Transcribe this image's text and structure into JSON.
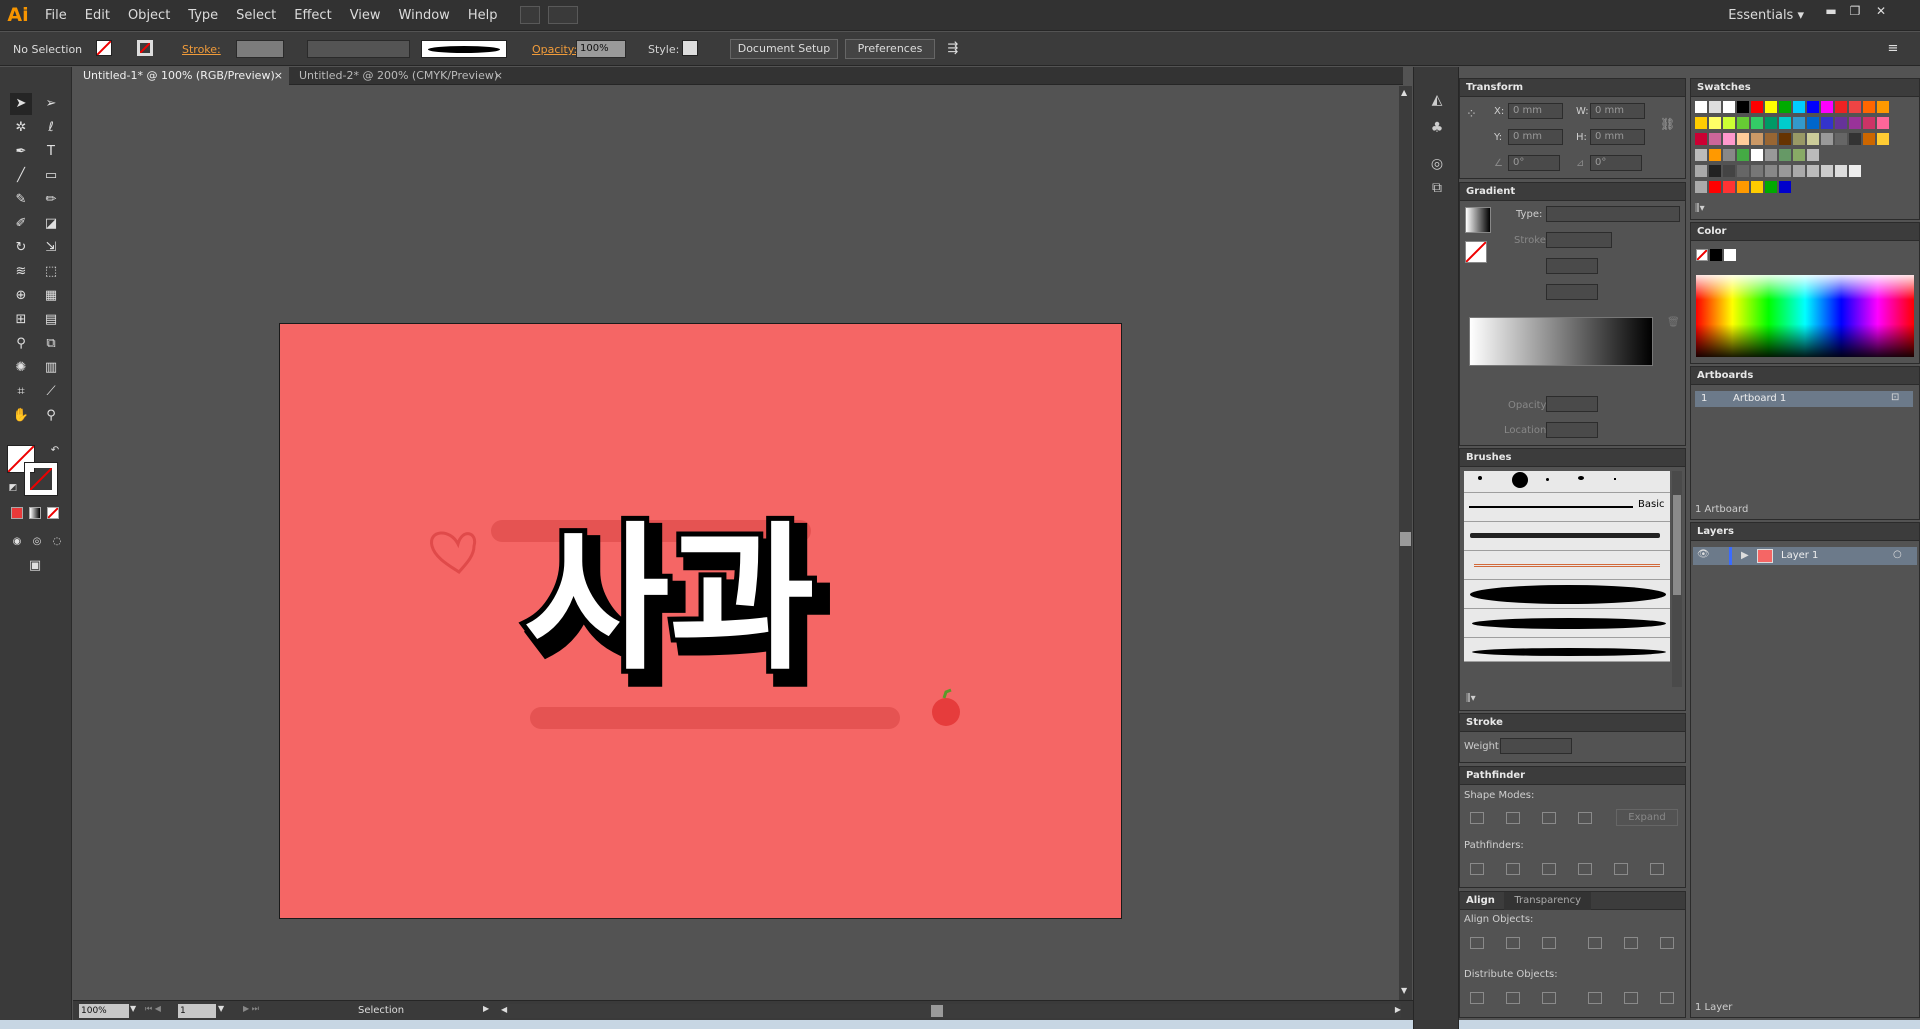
{
  "app": {
    "logo": "Ai"
  },
  "menu": [
    "File",
    "Edit",
    "Object",
    "Type",
    "Select",
    "Effect",
    "View",
    "Window",
    "Help"
  ],
  "workspace": "Essentials",
  "control": {
    "selection": "No Selection",
    "stroke_label": "Stroke:",
    "opacity_label": "Opacity:",
    "opacity_value": "100%",
    "style_label": "Style:",
    "doc_setup": "Document Setup",
    "preferences": "Preferences"
  },
  "tabs": [
    "Untitled-1* @ 100% (RGB/Preview)",
    "Untitled-2* @ 200% (CMYK/Preview)"
  ],
  "tab_close": "×",
  "artwork": {
    "text": "사과"
  },
  "status": {
    "zoom": "100%",
    "artboard_num": "1",
    "tool": "Selection"
  },
  "panels": {
    "transform": {
      "title": "Transform",
      "x_label": "X:",
      "x": "0 mm",
      "y_label": "Y:",
      "y": "0 mm",
      "w_label": "W:",
      "w": "0 mm",
      "h_label": "H:",
      "h": "0 mm",
      "angle": "0°",
      "shear": "0°"
    },
    "gradient": {
      "title": "Gradient",
      "type_label": "Type:",
      "stroke_label": "Stroke:",
      "opacity_label": "Opacity:",
      "location_label": "Location:"
    },
    "brushes": {
      "title": "Brushes",
      "basic": "Basic"
    },
    "stroke": {
      "title": "Stroke",
      "weight_label": "Weight:"
    },
    "pathfinder": {
      "title": "Pathfinder",
      "shape_modes": "Shape Modes:",
      "expand": "Expand",
      "pathfinders": "Pathfinders:"
    },
    "align": {
      "title": "Align",
      "tab2": "Transparency",
      "align_objects": "Align Objects:",
      "distribute_objects": "Distribute Objects:"
    },
    "swatches": {
      "title": "Swatches"
    },
    "color": {
      "title": "Color"
    },
    "artboards": {
      "title": "Artboards",
      "item_num": "1",
      "item_name": "Artboard 1",
      "count": "1 Artboard"
    },
    "layers": {
      "title": "Layers",
      "layer_name": "Layer 1",
      "count": "1 Layer"
    }
  },
  "colors": {
    "artboard": "#f56665",
    "ui_dark": "#323232",
    "accent_orange": "#f79500"
  }
}
